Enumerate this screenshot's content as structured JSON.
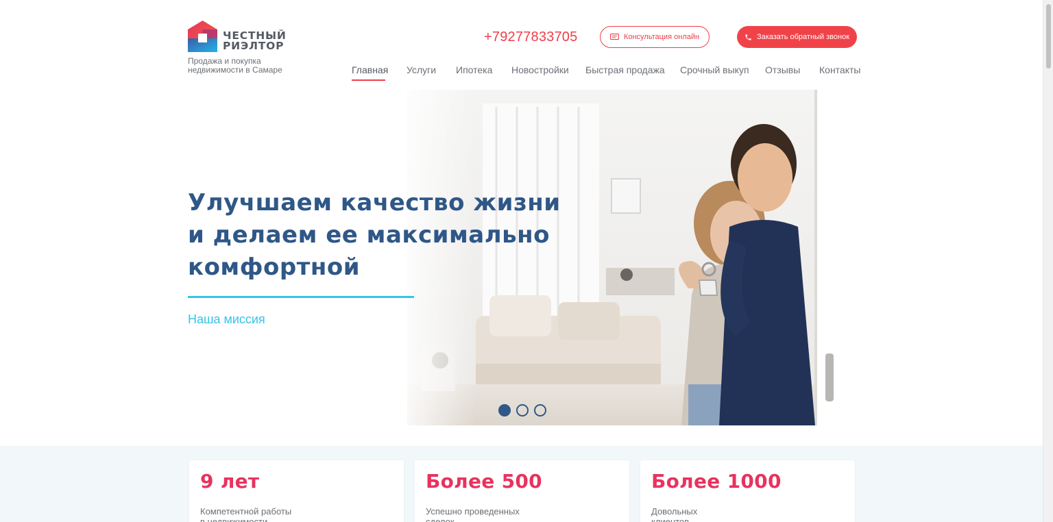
{
  "brand": {
    "name_line1": "ЧЕСТНЫЙ",
    "name_line2": "РИЭЛТОР",
    "tagline_line1": "Продажа и покупка",
    "tagline_line2": "недвижимости в Самаре",
    "colors": {
      "red": "#ef3e4a",
      "blue": "#2f5787",
      "cyan": "#34c4ec",
      "pink": "#e8335f"
    }
  },
  "header": {
    "phone": "+79277833705",
    "consult_button": "Консультация онлайн",
    "callback_button": "Заказать обратный звонок"
  },
  "nav": {
    "items": [
      {
        "label": "Главная",
        "active": true
      },
      {
        "label": "Услуги",
        "active": false
      },
      {
        "label": "Ипотека",
        "active": false
      },
      {
        "label": "Новостройки",
        "active": false
      },
      {
        "label": "Быстрая продажа",
        "active": false
      },
      {
        "label": "Срочный выкуп",
        "active": false
      },
      {
        "label": "Отзывы",
        "active": false
      },
      {
        "label": "Контакты",
        "active": false
      }
    ]
  },
  "hero": {
    "title_line1": "Улучшаем качество жизни",
    "title_line2": "и делаем ее максимально",
    "title_line3": "комфортной",
    "link": "Наша миссия",
    "slide_count": 3,
    "active_slide": 1
  },
  "stats": [
    {
      "number": "9 лет",
      "text_line1": "Компетентной работы",
      "text_line2": "в недвижимости"
    },
    {
      "number": "Более 500",
      "text_line1": "Успешно проведенных",
      "text_line2": "сделок"
    },
    {
      "number": "Более 1000",
      "text_line1": "Довольных",
      "text_line2": "клиентов"
    }
  ]
}
